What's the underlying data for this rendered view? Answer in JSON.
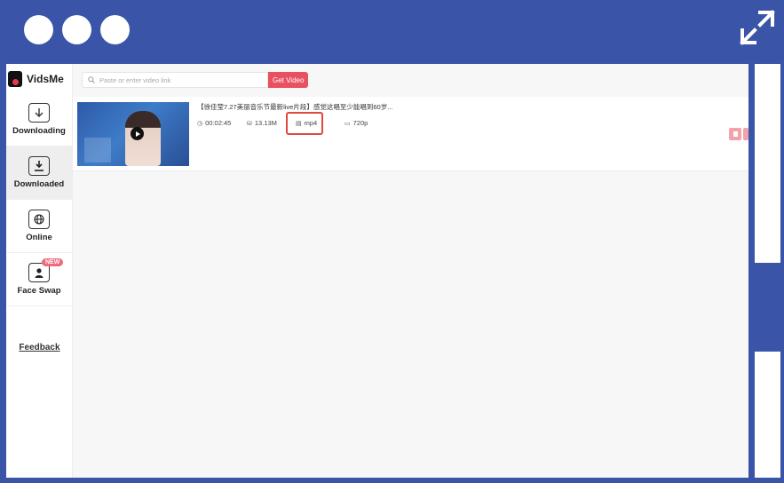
{
  "app": {
    "name": "VidsMe"
  },
  "sidebar": {
    "items": [
      {
        "label": "Downloading",
        "icon": "download-arrow-icon",
        "active": false
      },
      {
        "label": "Downloaded",
        "icon": "downloaded-tray-icon",
        "active": true
      },
      {
        "label": "Online",
        "icon": "globe-icon",
        "active": false
      },
      {
        "label": "Face Swap",
        "icon": "face-swap-icon",
        "active": false,
        "badge": "NEW"
      }
    ],
    "feedback": "Feedback"
  },
  "search": {
    "placeholder": "Paste or enter video link",
    "button": "Get Video"
  },
  "video": {
    "title": "【徐佳莹7.27美丽音乐节最新live片段】感觉这唱至少能唱到60岁...",
    "duration": "00:02:45",
    "size": "13.13M",
    "format": "mp4",
    "resolution": "720p"
  },
  "colors": {
    "accent": "#e8515f",
    "frame": "#3a55a8",
    "highlight": "#e04a3c"
  }
}
